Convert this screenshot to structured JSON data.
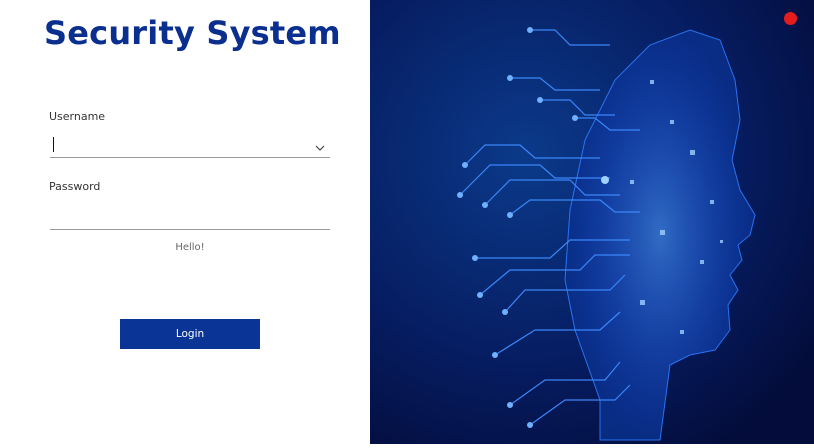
{
  "app": {
    "title": "Security System"
  },
  "form": {
    "username_label": "Username",
    "username_value": "",
    "password_label": "Password",
    "password_value": "",
    "status_text": "Hello!",
    "login_label": "Login"
  },
  "icons": {
    "dropdown": "chevron-down-icon",
    "close": "close-dot-icon",
    "hero": "ai-head-circuit-image"
  },
  "colors": {
    "title": "#0b2f8f",
    "button": "#0b3497",
    "hero_background": "#061a5c",
    "circuit": "#2f7bff",
    "close_dot": "#e41c1c"
  }
}
